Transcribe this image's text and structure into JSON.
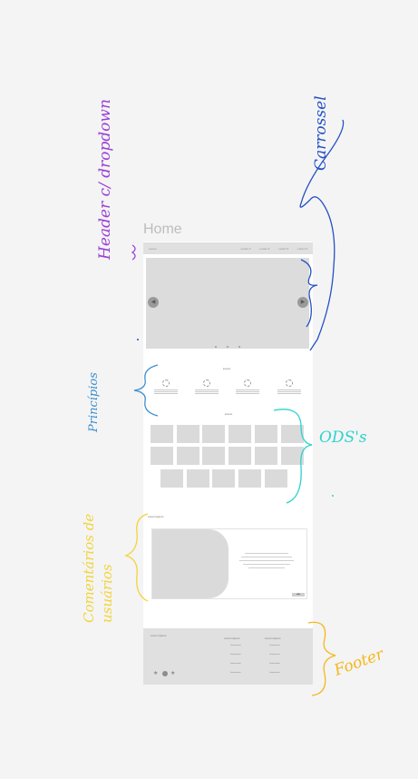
{
  "page": {
    "title": "Home"
  },
  "header": {
    "logo_label": "Lorem",
    "nav": [
      "Lorem ▾",
      "Lorem ▾",
      "Lorem ▾",
      "Lorem ▾"
    ]
  },
  "carousel": {
    "prev_label": "◀",
    "next_label": "▶",
    "indicator_count": 3
  },
  "features": {
    "heading": "Lorem",
    "items": [
      {
        "name": "Lorem"
      },
      {
        "name": "Lorem"
      },
      {
        "name": "Lorem"
      },
      {
        "name": "Lorem"
      }
    ]
  },
  "grid": {
    "heading": "Lorem"
  },
  "testimonials": {
    "heading": "Lorem ipsum",
    "pager_label": "◀ ▶"
  },
  "footer": {
    "brand": "Lorem ipsum",
    "col1": {
      "title": "Lorem ipsum",
      "links": [
        "Lorem ipsum",
        "Lorem ipsum",
        "Lorem ipsum",
        "Lorem ipsum"
      ]
    },
    "col2": {
      "title": "Lorem ipsum",
      "links": [
        "Lorem ipsum",
        "Lorem ipsum",
        "Lorem ipsum",
        "Lorem ipsum"
      ]
    }
  },
  "annotations": {
    "header": "Header c/ dropdown",
    "carousel": "Carrossel",
    "principles": "Princípios",
    "ods": "ODS's",
    "comments": "Comentários de usuários",
    "footer": "Footer"
  },
  "colors": {
    "purple": "#9b3fd6",
    "blue": "#2450c4",
    "light_blue": "#3d8fd0",
    "cyan": "#2bd3d0",
    "yellow": "#f2d43a",
    "orange": "#f5b81c"
  }
}
